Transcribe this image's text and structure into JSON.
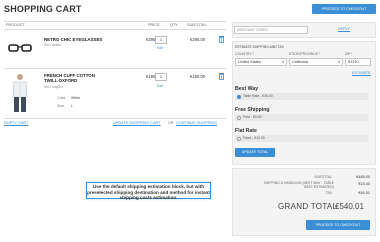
{
  "page": {
    "title": "SHOPPING CART",
    "checkout_label": "PROCEED TO CHECKOUT"
  },
  "table": {
    "headers": [
      "PRODUCT",
      "PRICE",
      "QTY",
      "SUBTOTAL"
    ]
  },
  "items": [
    {
      "name": "RETRO CHIC EYEGLASSES",
      "sku": "SKU: acsao",
      "price": "€295.00",
      "qty": "1",
      "edit": "Edit",
      "subtotal": "€295.00"
    },
    {
      "name": "FRENCH CUFF COTTON TWILL OXFORD",
      "sku": "SKU: msj000",
      "color_label": "Color",
      "color_value": "White",
      "size_label": "Size",
      "size_value": "L",
      "price": "€190.00",
      "qty": "1",
      "edit": "Edit",
      "subtotal": "€190.00"
    }
  ],
  "links": {
    "empty_cart": "EMPTY CART",
    "update_cart": "UPDATE SHOPPING CART",
    "or": "OR",
    "continue": "CONTINUE SHOPPING"
  },
  "discount": {
    "label": "DISCOUNT CODES",
    "apply": "APPLY"
  },
  "estimate": {
    "heading": "ESTIMATE SHIPPING AND TAX",
    "country_label": "COUNTRY *",
    "country_value": "United States",
    "state_label": "STATE/PROVINCE *",
    "state_value": "California",
    "zip_label": "ZIP *",
    "zip_value": "91210",
    "estimate_link": "ESTIMATE",
    "best_way_title": "Best Way",
    "best_way_option": "Table Rate - €45.00",
    "free_title": "Free Shipping",
    "free_option": "Free - €0.00",
    "flat_title": "Flat Rate",
    "flat_option": "Fixed - €10.00",
    "update_total": "UPDATE TOTAL"
  },
  "summary": {
    "subtotal_label": "SUBTOTAL",
    "subtotal_value": "€485.00",
    "shipping_label": "SHIPPING & HANDLING (BEST WAY - TABLE RATE ESTIMATED)",
    "shipping_value": "€15.40",
    "tax_label": "TAX",
    "tax_value": "€40.01",
    "grand_label": "GRAND TOTAL",
    "grand_value": "€540.01",
    "checkout_label": "PROCEED TO CHECKOUT"
  },
  "callout": {
    "text": "Use the default shipping estimation block, but with preselected shipping destination and method for instant shipping costs estimation."
  },
  "colors": {
    "accent": "#3a8fd6"
  }
}
